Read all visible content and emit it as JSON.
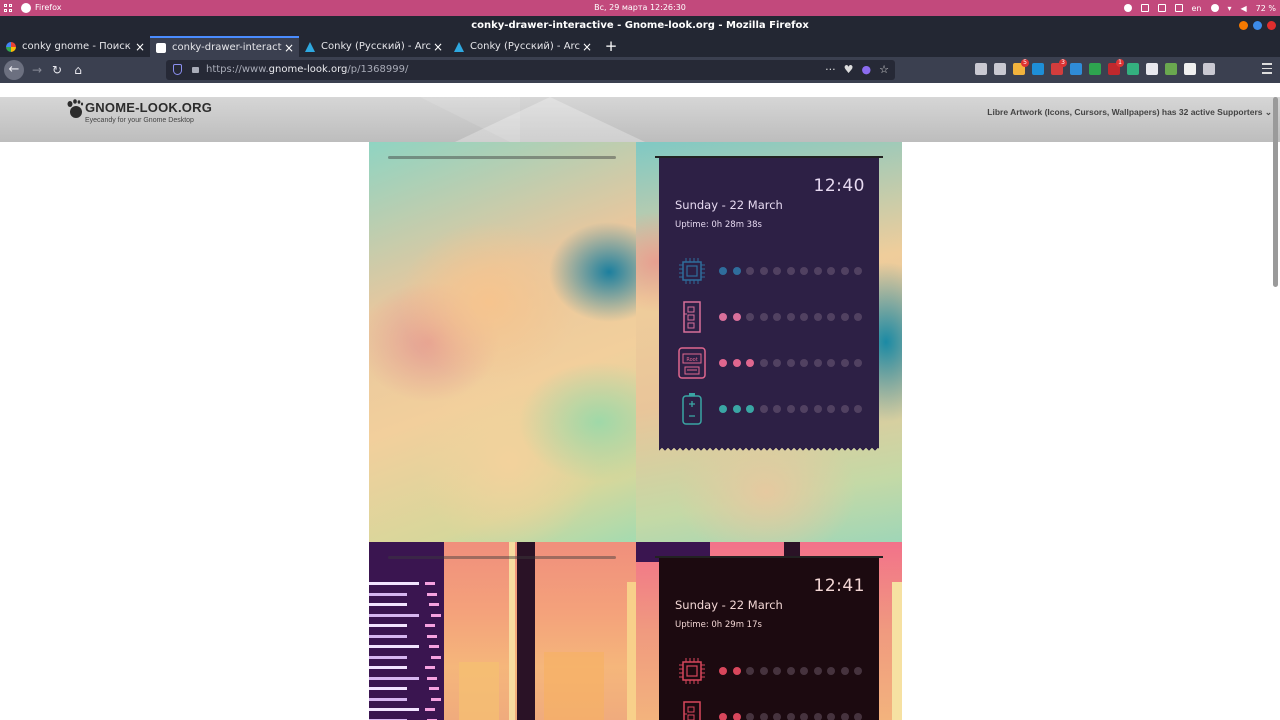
{
  "system_bar": {
    "app_name": "Firefox",
    "clock": "Вс, 29 марта  12:26:30",
    "keyboard_layout": "en",
    "battery": "72 %",
    "tray_icons": [
      "updates-icon",
      "clipboard-icon",
      "usb-icon",
      "package-icon",
      "keyboard-layout-indicator",
      "google-icon",
      "wifi-icon",
      "volume-icon",
      "battery-icon"
    ]
  },
  "window": {
    "title": "conky-drawer-interactive - Gnome-look.org - Mozilla Firefox",
    "button_colors": [
      "#f57900",
      "#3c8ae8",
      "#e02e2e"
    ]
  },
  "tabs": [
    {
      "label": "conky gnome - Поиск в",
      "icon": "google-icon",
      "active": false
    },
    {
      "label": "conky-drawer-interactiv",
      "icon": "gnome-look-icon",
      "active": true
    },
    {
      "label": "Conky (Русский) - ArchV",
      "icon": "arch-icon",
      "active": false
    },
    {
      "label": "Conky (Русский) - ArchV",
      "icon": "arch-icon",
      "active": false
    }
  ],
  "new_tab_label": "+",
  "navigation": {
    "url_prefix": "https://www.",
    "url_domain": "gnome-look.org",
    "url_path": "/p/1368999/",
    "url_actions": [
      "···",
      "pocket-icon",
      "extension-icon",
      "☆"
    ]
  },
  "extensions": [
    {
      "name": "library-icon",
      "color": "#c9c9d2",
      "badge": ""
    },
    {
      "name": "reader-icon",
      "color": "#c9c9d2",
      "badge": ""
    },
    {
      "name": "weather-icon",
      "color": "#f2b33d",
      "badge": "5"
    },
    {
      "name": "skype-icon",
      "color": "#1e8fd8",
      "badge": ""
    },
    {
      "name": "vk-music-icon",
      "color": "#d33d3d",
      "badge": "3"
    },
    {
      "name": "cloud-icon",
      "color": "#2f8cd8",
      "badge": ""
    },
    {
      "name": "dict-icon",
      "color": "#2ea44f",
      "badge": ""
    },
    {
      "name": "ublock-icon",
      "color": "#c0282d",
      "badge": "1"
    },
    {
      "name": "refresh-icon",
      "color": "#34b07f",
      "badge": ""
    },
    {
      "name": "apps-icon",
      "color": "#e8e8ee",
      "badge": ""
    },
    {
      "name": "download-icon",
      "color": "#6aa84f",
      "badge": ""
    },
    {
      "name": "gnome-icon",
      "color": "#f0f0f0",
      "badge": ""
    },
    {
      "name": "pen-icon",
      "color": "#c9c9d2",
      "badge": ""
    }
  ],
  "site": {
    "logo_text": "GNOME-LOOK.ORG",
    "tagline": "Eyecandy for your Gnome Desktop",
    "supporters": "Libre Artwork (Icons, Cursors, Wallpapers) has 32 active Supporters  ⌄"
  },
  "conky_widgets": [
    {
      "clock": "12:40",
      "date": "Sunday - 22 March",
      "uptime": "Uptime: 0h 28m 38s",
      "rows": [
        {
          "icon": "cpu-icon",
          "level": 2,
          "color": "#2f6d9c"
        },
        {
          "icon": "memory-icon",
          "level": 2,
          "color": "#d86f9a"
        },
        {
          "icon": "disk-root-icon",
          "level": 3,
          "color": "#e0678f"
        },
        {
          "icon": "battery-icon",
          "level": 3,
          "color": "#3aa6a4"
        }
      ]
    },
    {
      "clock": "12:41",
      "date": "Sunday - 22 March",
      "uptime": "Uptime: 0h 29m 17s",
      "rows": [
        {
          "icon": "cpu-icon",
          "level": 2,
          "color": "#d8475c"
        },
        {
          "icon": "memory-icon",
          "level": 2,
          "color": "#d8475c"
        }
      ]
    }
  ],
  "dot_count": 11
}
